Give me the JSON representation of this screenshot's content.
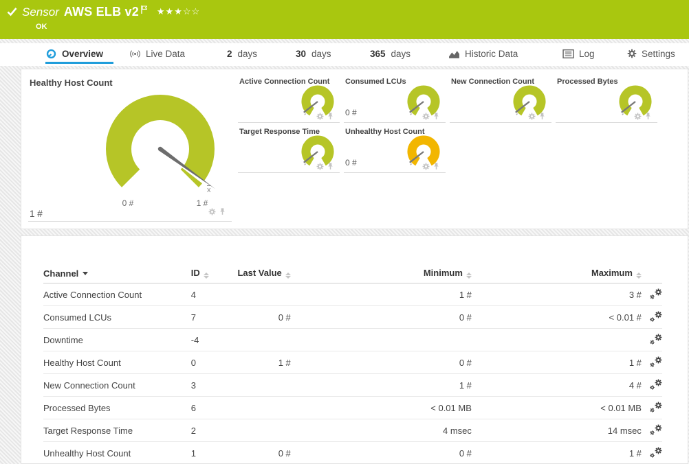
{
  "colors": {
    "header_green": "#a9c70f",
    "gauge_green": "#b6c527",
    "warning_yellow": "#f2b600",
    "accent_blue": "#1f9ddb"
  },
  "header": {
    "kind": "Sensor",
    "title": "AWS ELB v2",
    "stars_filled": "★★★",
    "stars_empty": "☆☆",
    "status": "OK"
  },
  "tabs": {
    "overview": {
      "label": "Overview"
    },
    "live": {
      "label": "Live Data"
    },
    "d2": {
      "num": "2",
      "unit": "days"
    },
    "d30": {
      "num": "30",
      "unit": "days"
    },
    "d365": {
      "num": "365",
      "unit": "days"
    },
    "historic": {
      "label": "Historic Data"
    },
    "log": {
      "label": "Log"
    },
    "settings": {
      "label": "Settings"
    }
  },
  "gauges": {
    "main": {
      "title": "Healthy Host Count",
      "last_value": "1 #",
      "scale_min": "0 #",
      "scale_max": "1 #",
      "avg_label": "x",
      "color": "#b6c527"
    },
    "small": [
      {
        "title": "Active Connection Count",
        "last_value": "",
        "color": "#b6c527"
      },
      {
        "title": "Consumed LCUs",
        "last_value": "0 #",
        "color": "#b6c527"
      },
      {
        "title": "New Connection Count",
        "last_value": "",
        "color": "#b6c527"
      },
      {
        "title": "Processed Bytes",
        "last_value": "",
        "color": "#b6c527"
      },
      {
        "title": "Target Response Time",
        "last_value": "",
        "color": "#b6c527"
      },
      {
        "title": "Unhealthy Host Count",
        "last_value": "0 #",
        "color": "#f2b600"
      }
    ]
  },
  "table": {
    "headers": {
      "channel": "Channel",
      "id": "ID",
      "last_value": "Last Value",
      "minimum": "Minimum",
      "maximum": "Maximum"
    },
    "rows": [
      {
        "channel": "Active Connection Count",
        "id": "4",
        "last": "",
        "min": "1 #",
        "max": "3 #"
      },
      {
        "channel": "Consumed LCUs",
        "id": "7",
        "last": "0 #",
        "min": "0 #",
        "max": "< 0.01 #"
      },
      {
        "channel": "Downtime",
        "id": "-4",
        "last": "",
        "min": "",
        "max": ""
      },
      {
        "channel": "Healthy Host Count",
        "id": "0",
        "last": "1 #",
        "min": "0 #",
        "max": "1 #"
      },
      {
        "channel": "New Connection Count",
        "id": "3",
        "last": "",
        "min": "1 #",
        "max": "4 #"
      },
      {
        "channel": "Processed Bytes",
        "id": "6",
        "last": "",
        "min": "< 0.01 MB",
        "max": "< 0.01 MB"
      },
      {
        "channel": "Target Response Time",
        "id": "2",
        "last": "",
        "min": "4 msec",
        "max": "14 msec"
      },
      {
        "channel": "Unhealthy Host Count",
        "id": "1",
        "last": "0 #",
        "min": "0 #",
        "max": "1 #"
      }
    ]
  }
}
